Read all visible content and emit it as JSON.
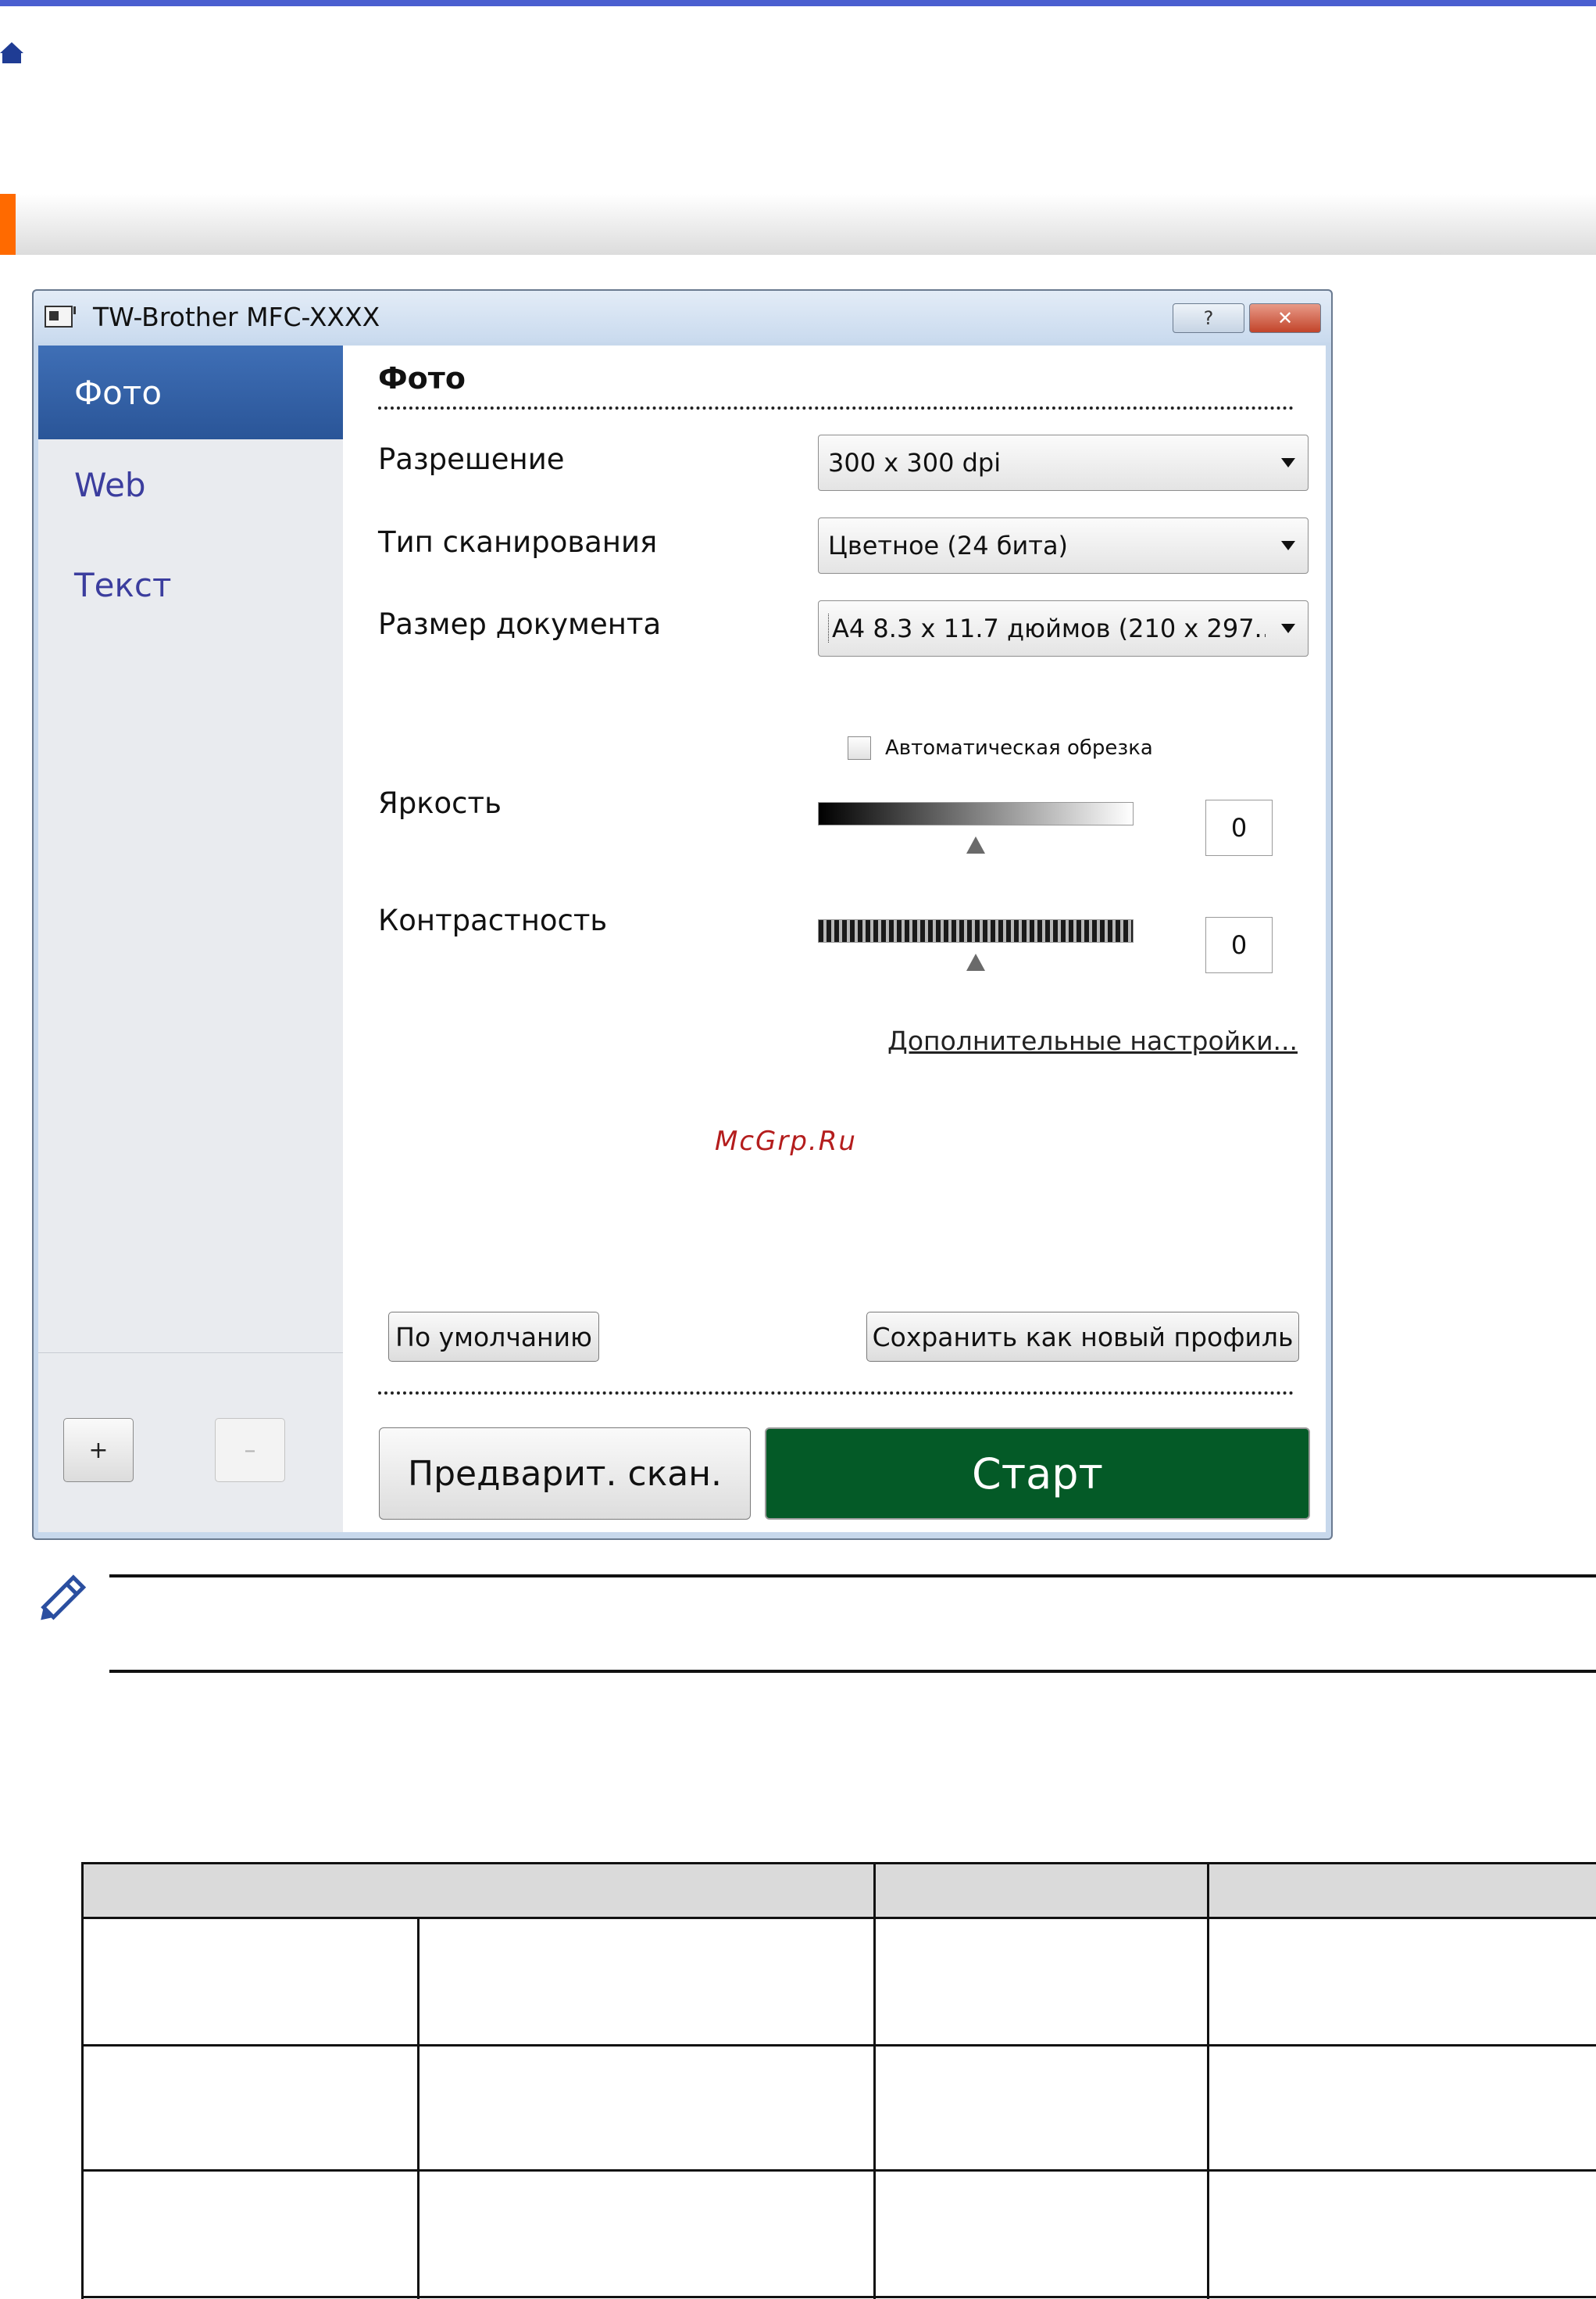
{
  "page": {
    "accent_color": "#4a5fd0",
    "section_accent_color": "#ff6a00",
    "home_icon": "home-icon",
    "note_icon": "pencil-icon"
  },
  "dialog": {
    "title": "TW-Brother MFC-XXXX",
    "help_label": "?",
    "close_label": "✕",
    "sidebar": {
      "items": [
        {
          "label": "Фото",
          "active": true
        },
        {
          "label": "Web",
          "active": false
        },
        {
          "label": "Текст",
          "active": false
        }
      ],
      "add_label": "+",
      "remove_label": "–"
    },
    "panel": {
      "title": "Фото",
      "resolution": {
        "label": "Разрешение",
        "value": "300 x 300 dpi"
      },
      "scan_type": {
        "label": "Тип сканирования",
        "value": "Цветное (24 бита)"
      },
      "document_size": {
        "label": "Размер документа",
        "value": "A4 8.3 x 11.7 дюймов (210 x 297..."
      },
      "auto_crop": {
        "label": "Автоматическая обрезка",
        "checked": false
      },
      "brightness": {
        "label": "Яркость",
        "value": "0",
        "level": 0.5
      },
      "contrast": {
        "label": "Контрастность",
        "value": "0",
        "level": 0.5
      },
      "advanced_link": "Дополнительные настройки...",
      "watermark": "McGrp.Ru",
      "default_button": "По умолчанию",
      "save_profile_button": "Сохранить как новый профиль",
      "prescan_button": "Предварит. скан.",
      "start_button": "Старт",
      "start_color": "#045a27"
    }
  }
}
